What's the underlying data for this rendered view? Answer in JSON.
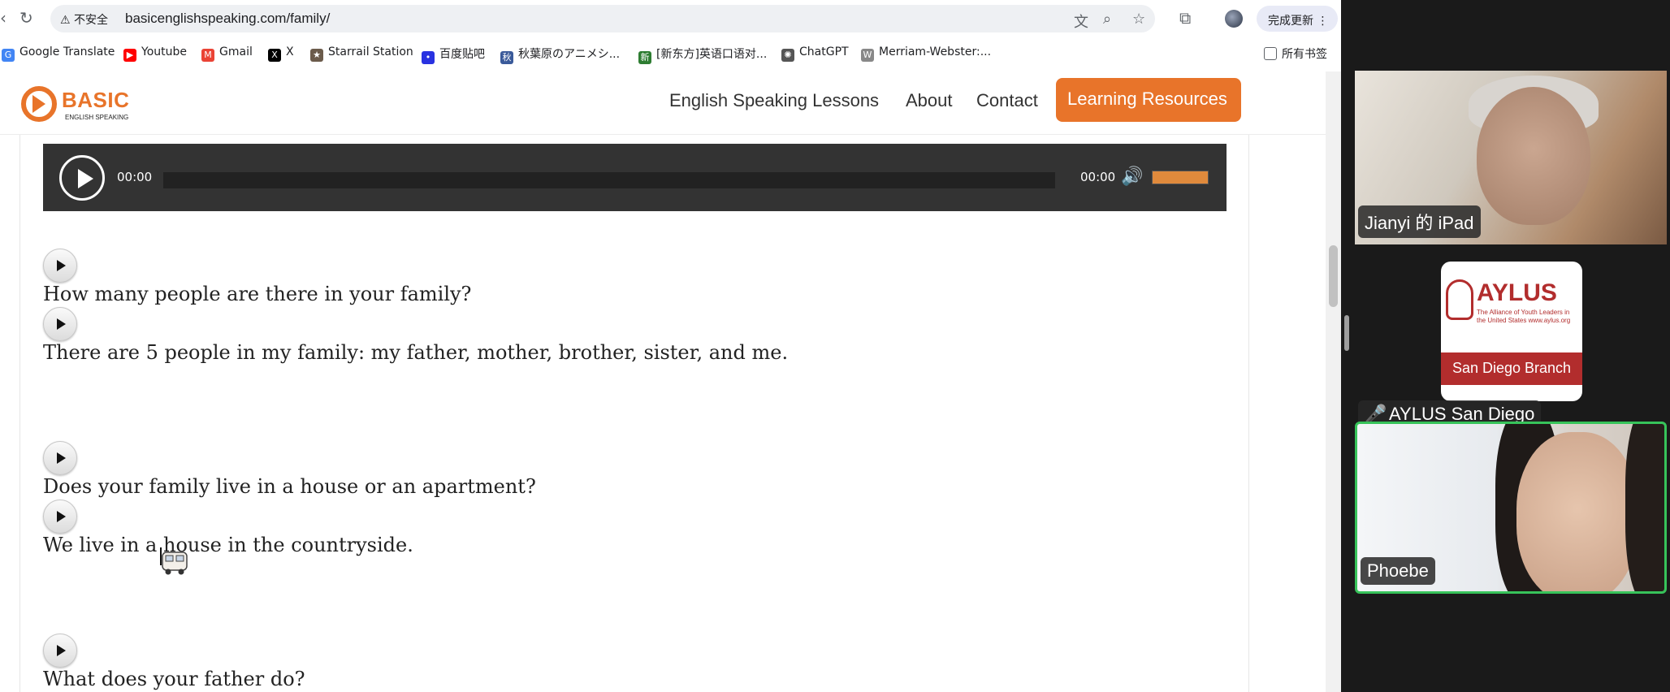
{
  "browser": {
    "security_label": "⚠ 不安全",
    "url": "basicenglishspeaking.com/family/",
    "update_label": "完成更新",
    "bookmarks": [
      {
        "label": "Google Translate",
        "icon": "translate-icon",
        "color": "#4285f4"
      },
      {
        "label": "Youtube",
        "icon": "youtube-icon",
        "color": "#ff0000"
      },
      {
        "label": "Gmail",
        "icon": "gmail-icon",
        "color": "#ea4335"
      },
      {
        "label": "X",
        "icon": "x-icon",
        "color": "#000000"
      },
      {
        "label": "Starrail Station",
        "icon": "starrail-icon",
        "color": "#6b5b4b"
      },
      {
        "label": "百度贴吧",
        "icon": "baidu-icon",
        "color": "#2932e1"
      },
      {
        "label": "秋葉原のアニメシ...",
        "icon": "akiba-icon",
        "color": "#3a5a9a"
      },
      {
        "label": "[新东方]英语口语对...",
        "icon": "xdf-icon",
        "color": "#2e7d32"
      },
      {
        "label": "ChatGPT",
        "icon": "chatgpt-icon",
        "color": "#555555"
      },
      {
        "label": "Merriam-Webster:...",
        "icon": "mw-icon",
        "color": "#888888"
      }
    ],
    "all_bookmarks_label": "所有书签"
  },
  "site": {
    "logo_title": "BASIC",
    "logo_subtitle": "ENGLISH SPEAKING",
    "nav": [
      "English Speaking Lessons",
      "About",
      "Contact"
    ],
    "cta": "Learning Resources",
    "accent": "#e8742a"
  },
  "player": {
    "current_time": "00:00",
    "duration": "00:00",
    "progress": 0,
    "volume": 1.0
  },
  "dialog": [
    "How many people are there in your family?",
    "There are 5 people in my family: my father, mother, brother, sister, and me.",
    "Does your family live in a house or an apartment?",
    "We live in a house in the countryside.",
    "What does your father do?"
  ],
  "video": {
    "participants": [
      {
        "name": "Jianyi 的 iPad"
      },
      {
        "name": "AYLUS San Diego",
        "muted": true
      },
      {
        "name": "Phoebe",
        "active_speaker": true
      }
    ],
    "aylus_card": {
      "title": "AYLUS",
      "subtitle": "The Alliance of Youth Leaders in the United States www.aylus.org",
      "band": "San Diego Branch"
    }
  }
}
